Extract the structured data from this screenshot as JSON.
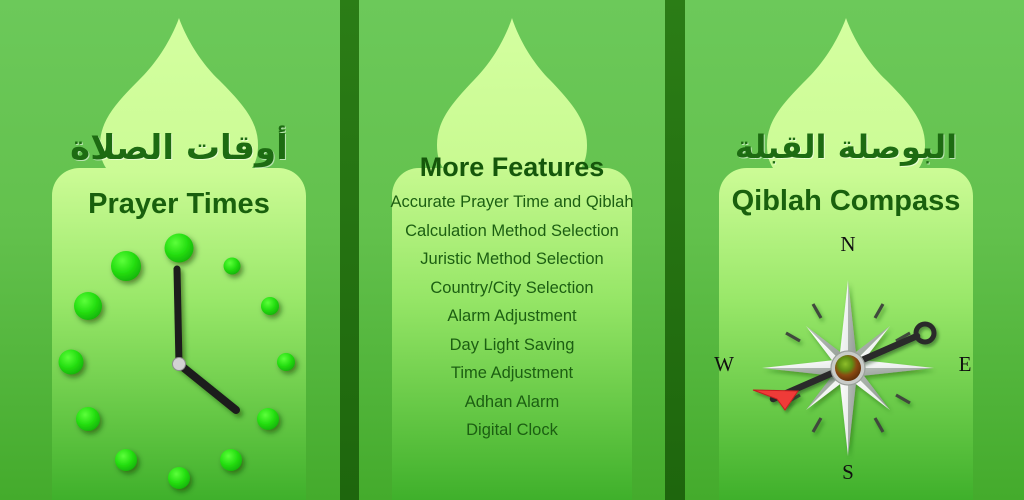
{
  "background": {
    "color_top": "#6cc95a",
    "color_bottom": "#44ab2c",
    "divider_color": "#236f10"
  },
  "panels": {
    "left": {
      "name": "prayer-times",
      "arabic_title": "أوقات الصلاة",
      "english_title": "Prayer Times",
      "panel_color_top": "#d2ff9e",
      "panel_color_bottom": "#3fb02b",
      "clock": {
        "marker_color": "#27e015",
        "hand_color": "#1a1a1a",
        "hub_color": "#cfcfcf",
        "minute_hand_target": "12",
        "hour_hand_target": "4",
        "hour_markers": [
          "12",
          "1",
          "2",
          "3",
          "4",
          "5",
          "6",
          "7",
          "8",
          "9",
          "10",
          "11"
        ]
      }
    },
    "middle": {
      "name": "more-features",
      "heading": "More Features",
      "features": [
        "Accurate Prayer Time and Qiblah",
        "Calculation Method Selection",
        "Juristic Method Selection",
        "Country/City Selection",
        "Alarm Adjustment",
        "Day Light Saving",
        "Time Adjustment",
        "Adhan Alarm",
        "Digital Clock"
      ],
      "panel_color_top": "#d2ff9e",
      "panel_color_bottom": "#3fb02b"
    },
    "right": {
      "name": "qiblah-compass",
      "arabic_title": "البوصلة القبلة",
      "english_title": "Qiblah Compass",
      "panel_color_top": "#d2ff9e",
      "panel_color_bottom": "#3fb02b",
      "compass": {
        "cardinals": {
          "north": "N",
          "east": "E",
          "south": "S",
          "west": "W"
        },
        "rose_color": "#e8ecea",
        "rose_shadow_color": "#9aa39d",
        "needle_color": "#2a2a2a",
        "needle_arrow_color": "#ef3b38",
        "hub_outer_color": "#c8cbc8",
        "hub_mid_color": "#7a3c10",
        "hub_inner_color": "#5f8f14",
        "needle_bearing_degrees": 245
      }
    }
  }
}
